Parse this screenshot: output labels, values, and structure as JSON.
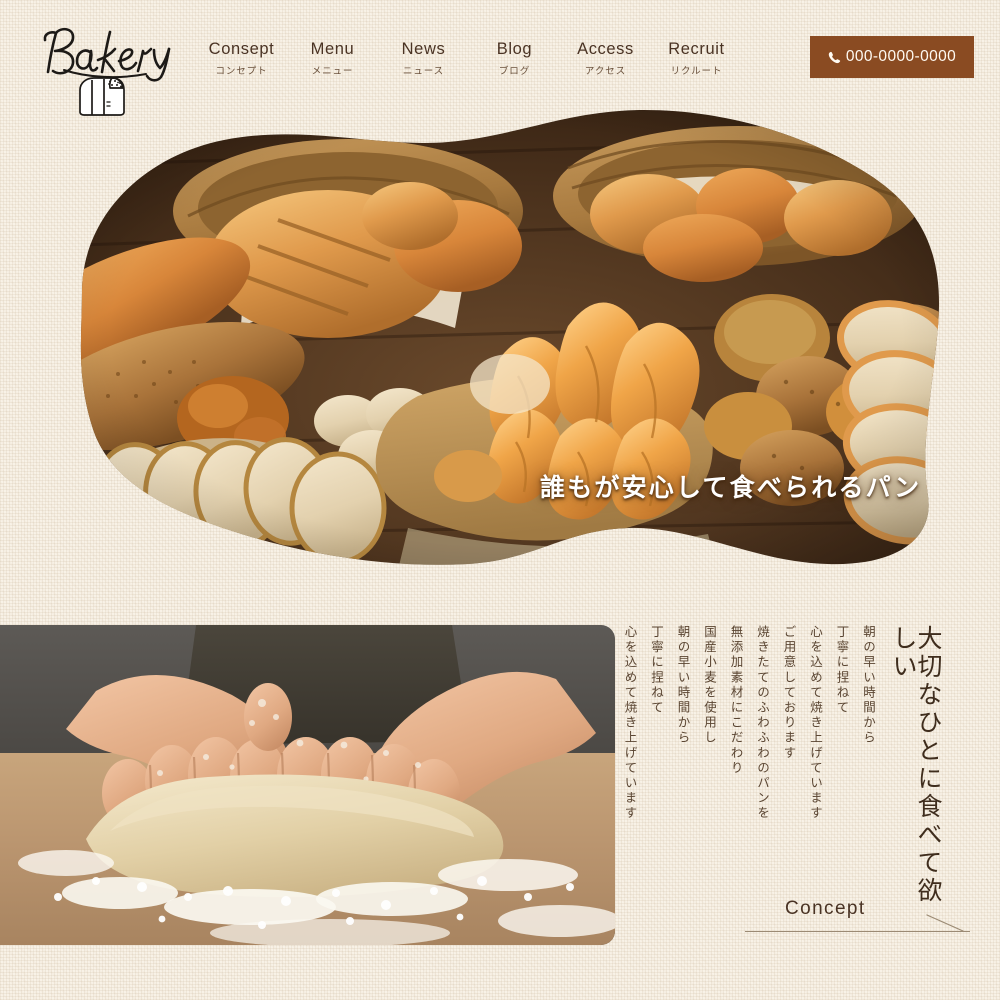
{
  "site": {
    "brand_name": "Bakery",
    "logo_icon": "bread-loaf-icon",
    "accent_brown": "#8a4b22",
    "text_brown": "#4a3324",
    "paper_bg": "#f8f2e7"
  },
  "header": {
    "nav": [
      {
        "en": "Consept",
        "jp": "コンセプト",
        "name": "concept"
      },
      {
        "en": "Menu",
        "jp": "メニュー",
        "name": "menu"
      },
      {
        "en": "News",
        "jp": "ニュース",
        "name": "news"
      },
      {
        "en": "Blog",
        "jp": "ブログ",
        "name": "blog"
      },
      {
        "en": "Access",
        "jp": "アクセス",
        "name": "access"
      },
      {
        "en": "Recruit",
        "jp": "リクルート",
        "name": "recruit"
      }
    ],
    "tel": {
      "number": "000-0000-0000",
      "icon": "phone-icon"
    }
  },
  "hero": {
    "caption": "誰もが安心して食べられるパン",
    "image_alt": "assorted-breads-baskets-photo"
  },
  "concept": {
    "image_alt": "hands-kneading-dough-photo",
    "heading": "大切なひとに食べて欲しい",
    "body_columns": [
      "朝の早い時間から",
      "丁寧に捏ねて",
      "心を込めて焼き上げています",
      "ご用意しております",
      "焼きたてのふわふわのパンを",
      "無添加素材にこだわり",
      "国産小麦を使用し",
      "朝の早い時間から",
      "丁寧に捏ねて",
      "心を込めて焼き上げています"
    ],
    "link_label": "Concept",
    "link_arrow_icon": "diagonal-arrow-icon"
  }
}
